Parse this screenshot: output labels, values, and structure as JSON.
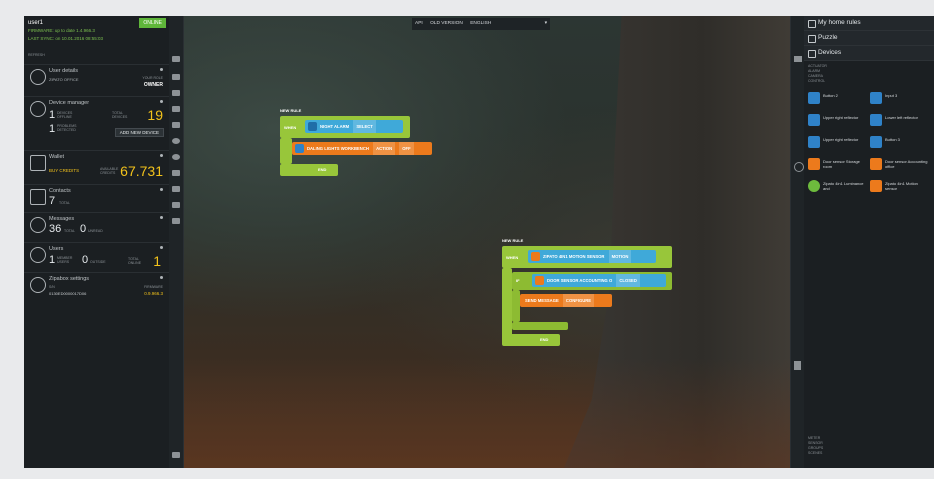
{
  "top_bar": {
    "api": "API",
    "old_version": "OLD VERSION",
    "language": "ENGLISH"
  },
  "left_panel": {
    "user": "user1",
    "status": "ONLINE",
    "firmware": "FIRMWARE: up to date 1.4.966.3",
    "last_sync": "LAST SYNC: on 10.01.2016 08:55:03",
    "refresh": "REFRESH",
    "user_details": {
      "title": "User details",
      "company": "ZIPATO OFFICE",
      "role_label": "YOUR ROLE",
      "role": "OWNER"
    },
    "device_manager": {
      "title": "Device manager",
      "devices": "1",
      "devices_label": "DEVICES OFFLINE",
      "problems": "1",
      "problems_label": "PROBLEMS DETECTED",
      "total": "19",
      "total_label": "TOTAL DEVICES",
      "add_button": "ADD NEW DEVICE"
    },
    "wallet": {
      "title": "Wallet",
      "buy": "BUY CREDITS",
      "credits_label": "AVAILABLE CREDITS",
      "credits": "67.731"
    },
    "contacts": {
      "title": "Contacts",
      "count": "7",
      "label": "TOTAL"
    },
    "messages": {
      "title": "Messages",
      "total": "36",
      "total_label": "TOTAL",
      "unread": "0",
      "unread_label": "UNREAD"
    },
    "users": {
      "title": "Users",
      "members": "1",
      "members_label": "MEMBER USERS",
      "outside": "0",
      "outside_label": "OUTSIDE",
      "total": "1",
      "total_label": "TOTAL ONLINE"
    },
    "settings": {
      "title": "Zipabox settings",
      "serial_label": "S/N",
      "serial": "0130ED0000017D06",
      "fw_label": "FIRMWARE",
      "fw": "0.9.966.3"
    }
  },
  "rule1": {
    "title": "NEW RULE",
    "when": "WHEN",
    "trigger": "NIGHT ALARM",
    "trigger_tag": "SELECT",
    "action": "DALING LIGHTS WORKBENCH",
    "action_tag": "ACTION",
    "action_value": "OFF",
    "end": "END"
  },
  "rule2": {
    "title": "NEW RULE",
    "when": "WHEN",
    "trigger": "ZIPATO 4IN1 MOTION SENSOR",
    "trigger_tag": "MOTION",
    "if": "IF",
    "cond": "DOOR SENSOR ACCOUNTING O",
    "cond_tag": "CLOSED",
    "send": "SEND MESSAGE",
    "send_tag": "CONFIGURE",
    "end": "END"
  },
  "right_panel": {
    "my_home_rules": "My home rules",
    "puzzle": "Puzzle",
    "devices": "Devices",
    "categories_top": [
      "ACTUATOR",
      "ALARM",
      "CAMERA",
      "CONTROL"
    ],
    "devices_list": [
      {
        "label": "Button 2",
        "color": "#2f82c8"
      },
      {
        "label": "Input 3",
        "color": "#2f82c8"
      },
      {
        "label": "Upper right reflector",
        "color": "#2f82c8"
      },
      {
        "label": "Lower left reflector",
        "color": "#2f82c8"
      },
      {
        "label": "Upper right reflector",
        "color": "#2f82c8"
      },
      {
        "label": "Button 3",
        "color": "#2f82c8"
      },
      {
        "label": "Door sensor Storage room",
        "color": "#ec7a1c"
      },
      {
        "label": "Door sensor Accounting office",
        "color": "#ec7a1c"
      },
      {
        "label": "Zipato 4in1 Luminance and",
        "color": "#6dbb3d"
      },
      {
        "label": "Zipato 4in1 Motion sensor",
        "color": "#ec7a1c"
      }
    ],
    "categories_bottom": [
      "METER",
      "SENSOR",
      "GROUPS",
      "SCENES"
    ]
  },
  "colors": {
    "accent_green": "#98c63a",
    "accent_blue": "#3fa9d9",
    "accent_orange": "#ec7a1c",
    "online_green": "#5fb63a",
    "credit_yellow": "#f2c21b"
  }
}
